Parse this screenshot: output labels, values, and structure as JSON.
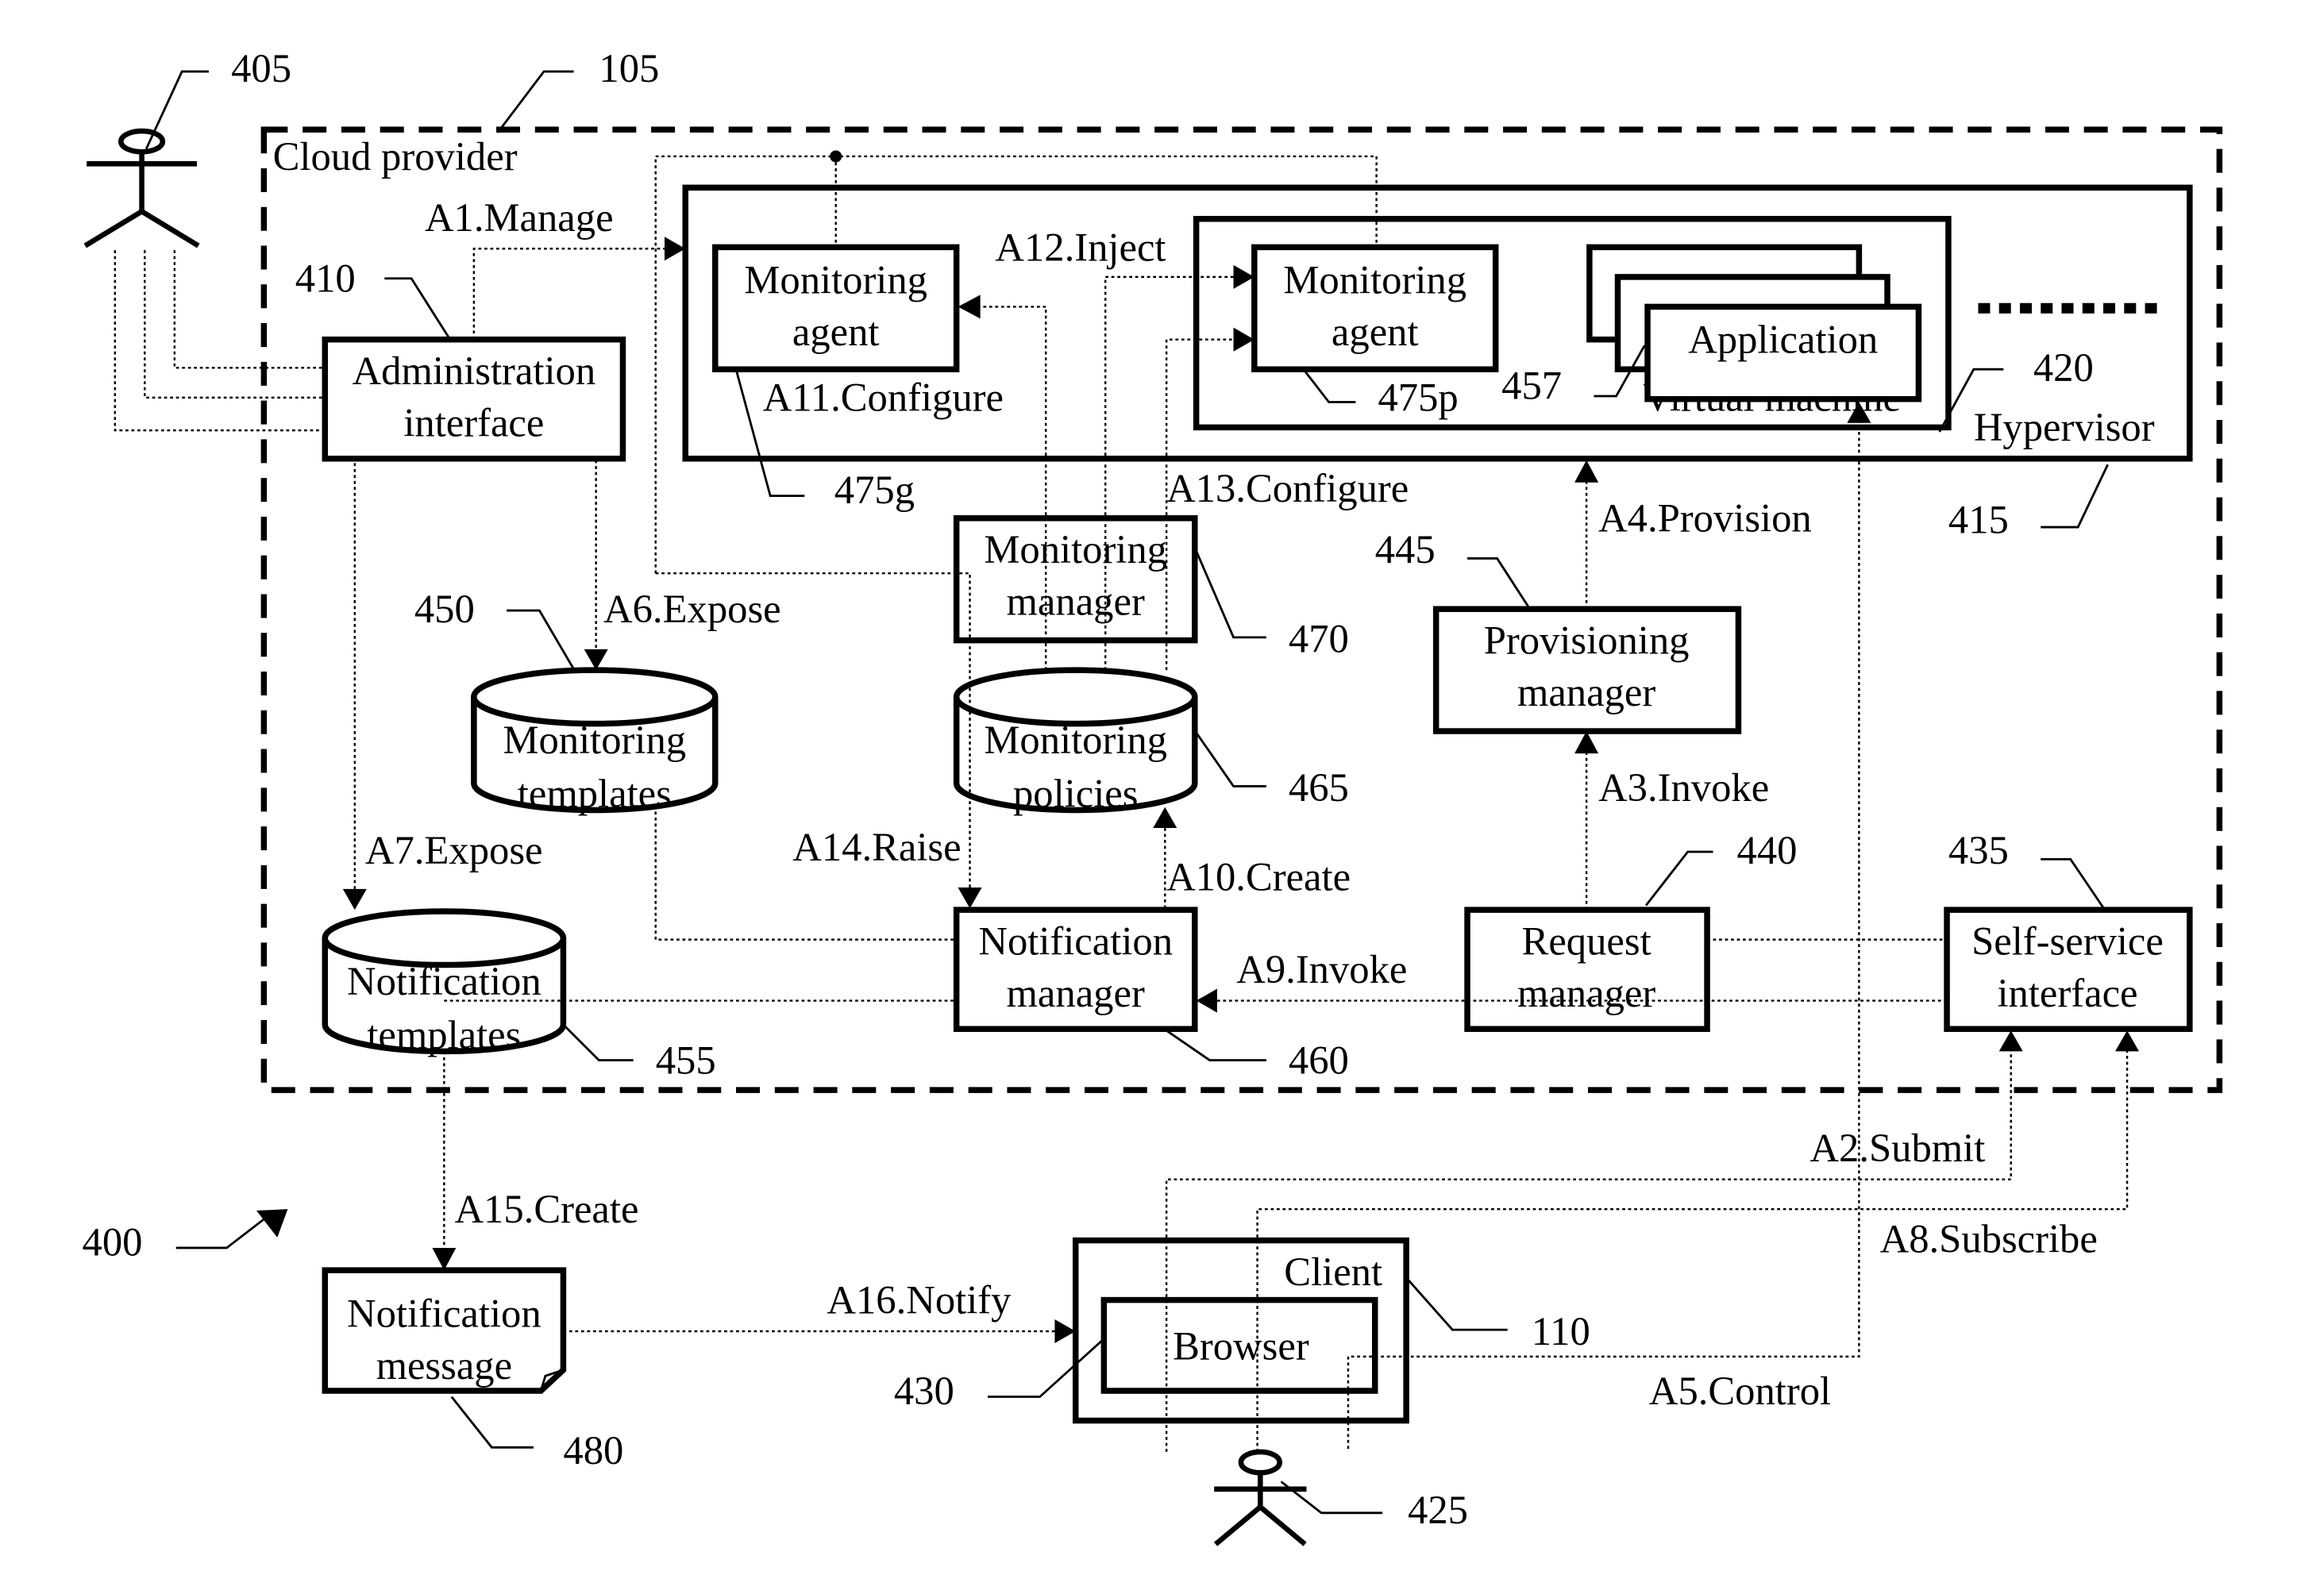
{
  "figure": {
    "ref": "400",
    "cloud": {
      "label": "Cloud provider",
      "ref": "105"
    }
  },
  "actors": {
    "administrator": {
      "ref": "405",
      "icon": "stick-figure"
    },
    "user": {
      "ref": "425",
      "icon": "stick-figure"
    }
  },
  "components": {
    "admin_interface": {
      "lines": [
        "Administration",
        "interface"
      ],
      "ref": "410"
    },
    "hypervisor": {
      "label": "Hypervisor",
      "ref": "415"
    },
    "virtual_machine": {
      "label": "Virtual machine",
      "ref": "420"
    },
    "application": {
      "label": "Application",
      "ref": "457"
    },
    "agent_g": {
      "lines": [
        "Monitoring",
        "agent"
      ],
      "ref": "475g"
    },
    "agent_p": {
      "lines": [
        "Monitoring",
        "agent"
      ],
      "ref": "475p"
    },
    "monitoring_manager": {
      "lines": [
        "Monitoring",
        "manager"
      ],
      "ref": "470"
    },
    "monitoring_templates": {
      "lines": [
        "Monitoring",
        "templates"
      ],
      "ref": "450"
    },
    "monitoring_policies": {
      "lines": [
        "Monitoring",
        "policies"
      ],
      "ref": "465"
    },
    "provisioning_manager": {
      "lines": [
        "Provisioning",
        "manager"
      ],
      "ref": "445"
    },
    "notification_templates": {
      "lines": [
        "Notification",
        "templates"
      ],
      "ref": "455"
    },
    "notification_manager": {
      "lines": [
        "Notification",
        "manager"
      ],
      "ref": "460"
    },
    "request_manager": {
      "lines": [
        "Request",
        "manager"
      ],
      "ref": "440"
    },
    "self_service": {
      "lines": [
        "Self-service",
        "interface"
      ],
      "ref": "435"
    },
    "notification_message": {
      "lines": [
        "Notification",
        "message"
      ],
      "ref": "480"
    },
    "client": {
      "label": "Client",
      "ref": "110"
    },
    "browser": {
      "label": "Browser",
      "ref": "430"
    }
  },
  "actions": {
    "a1": "A1.Manage",
    "a2": "A2.Submit",
    "a3": "A3.Invoke",
    "a4": "A4.Provision",
    "a5": "A5.Control",
    "a6": "A6.Expose",
    "a7": "A7.Expose",
    "a8": "A8.Subscribe",
    "a9": "A9.Invoke",
    "a10": "A10.Create",
    "a11": "A11.Configure",
    "a12": "A12.Inject",
    "a13": "A13.Configure",
    "a14": "A14.Raise",
    "a15": "A15.Create",
    "a16": "A16.Notify"
  }
}
